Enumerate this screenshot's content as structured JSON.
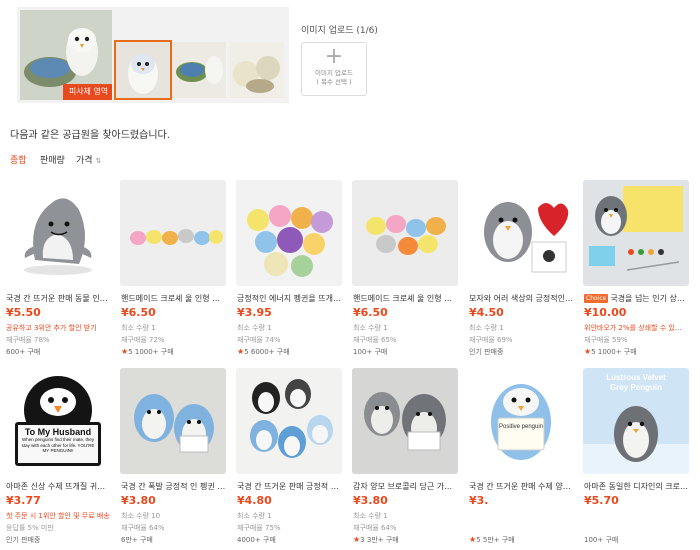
{
  "search_image": {
    "area_label": "피사체 영역"
  },
  "upload": {
    "title": "이미지 업로드 (1/6)",
    "box_line1": "이미지 업로드",
    "box_line2": "( 복수 선택 )"
  },
  "heading": "다음과 같은 공급원을 찾아드렸습니다.",
  "sort_tabs": [
    "종합",
    "판매량",
    "가격"
  ],
  "accent_color": "#e8491d",
  "products": [
    {
      "title": "국경 간 뜨거운 판매 동물 인형 ...",
      "price": "¥5.50",
      "line1": "공유하고 3위안 추가 할인 받기",
      "line1_red": true,
      "line2": "재구매율 78%",
      "line3": "600+ 구매",
      "stars": "",
      "badge": "",
      "image": "shark-icon"
    },
    {
      "title": "핸드메이드 크로셰 울 인형 펜던...",
      "price": "¥6.50",
      "line1": "최소 수량 1",
      "line1_red": false,
      "line2": "재구매율 72%",
      "line3": "1000+ 구매",
      "stars": "5",
      "badge": "",
      "image": "mini-chicks-icon"
    },
    {
      "title": "긍정적인 에너지 펭귄을 뜨개질한...",
      "price": "¥3.95",
      "line1": "최소 수량 1",
      "line1_red": false,
      "line2": "재구매율 74%",
      "line3": "6000+ 구매",
      "stars": "5",
      "badge": "",
      "image": "chick-pile-icon"
    },
    {
      "title": "핸드메이드 크로셰 울 인형 펜던...",
      "price": "¥6.50",
      "line1": "최소 수량 1",
      "line1_red": false,
      "line2": "재구매율 65%",
      "line3": "100+ 구매",
      "stars": "",
      "badge": "",
      "image": "chick-pile-icon"
    },
    {
      "title": "모자와 어러 색상의 긍정적인 작...",
      "price": "¥4.50",
      "line1": "최소 수량 1",
      "line1_red": false,
      "line2": "재구매율 69%",
      "line3": "인기 판매중",
      "stars": "",
      "badge": "",
      "image": "penguin-heart-icon"
    },
    {
      "title": "국경을 넘는 인기 상품, ...",
      "price": "¥10.00",
      "line1": "위안바오가 2%를 상쇄할 수 있...",
      "line1_red": true,
      "line2": "재구매율 59%",
      "line3": "1000+ 구매",
      "stars": "5",
      "badge": "Choice",
      "image": "penguin-kit-icon"
    },
    {
      "title": "아마존 신상 수제 뜨개질 귀여운 ...",
      "price": "¥3.77",
      "line1": "첫 주문 시 1위안 할인 및 무료 배송",
      "line1_red": true,
      "line2": "응답률 5% 미만",
      "line3": "인기 판매중",
      "stars": "",
      "badge": "",
      "image": "penguin-husband-icon"
    },
    {
      "title": "국경 간 폭발 긍정적 인 펭귄 인...",
      "price": "¥3.80",
      "line1": "최소 수량 10",
      "line1_red": false,
      "line2": "재구매율 64%",
      "line3": "6만+ 구매",
      "stars": "",
      "badge": "",
      "image": "blue-penguins-icon"
    },
    {
      "title": "국경 간 뜨거운 판매 긍정적 인 ...",
      "price": "¥4.80",
      "line1": "최소 수량 1",
      "line1_red": false,
      "line2": "재구매율 75%",
      "line3": "4000+ 구매",
      "stars": "",
      "badge": "",
      "image": "penguin-group-icon"
    },
    {
      "title": "감자 양모 브로콜리 당근 가지 크...",
      "price": "¥3.80",
      "line1": "최소 수량 1",
      "line1_red": false,
      "line2": "재구매율 64%",
      "line3": "3만+ 구매",
      "stars": "3",
      "badge": "",
      "image": "grey-penguins-icon"
    },
    {
      "title": "국경 간 뜨거운 판매 수제 양모 ...",
      "price": "¥3.",
      "line1": "",
      "line1_red": false,
      "line2": "",
      "line3": "5만+ 구매",
      "stars": "5",
      "badge": "",
      "image": "positive-penguin-icon"
    },
    {
      "title": "아마존 동일한 디자인의 크로바늘...",
      "price": "¥5.70",
      "line1": "",
      "line1_red": false,
      "line2": "",
      "line3": "100+ 구매",
      "stars": "",
      "badge": "",
      "image": "velvet-penguin-icon"
    }
  ],
  "poster_texts": {
    "husband_title": "To My Husband",
    "husband_body": "When penguins find their mate, they stay with each other for life. YOU'RE MY PENGUIN!!",
    "velvet_line1": "Lustrous Velvet",
    "velvet_line2": "Grey Penguin",
    "positive": "Positive penguin"
  }
}
